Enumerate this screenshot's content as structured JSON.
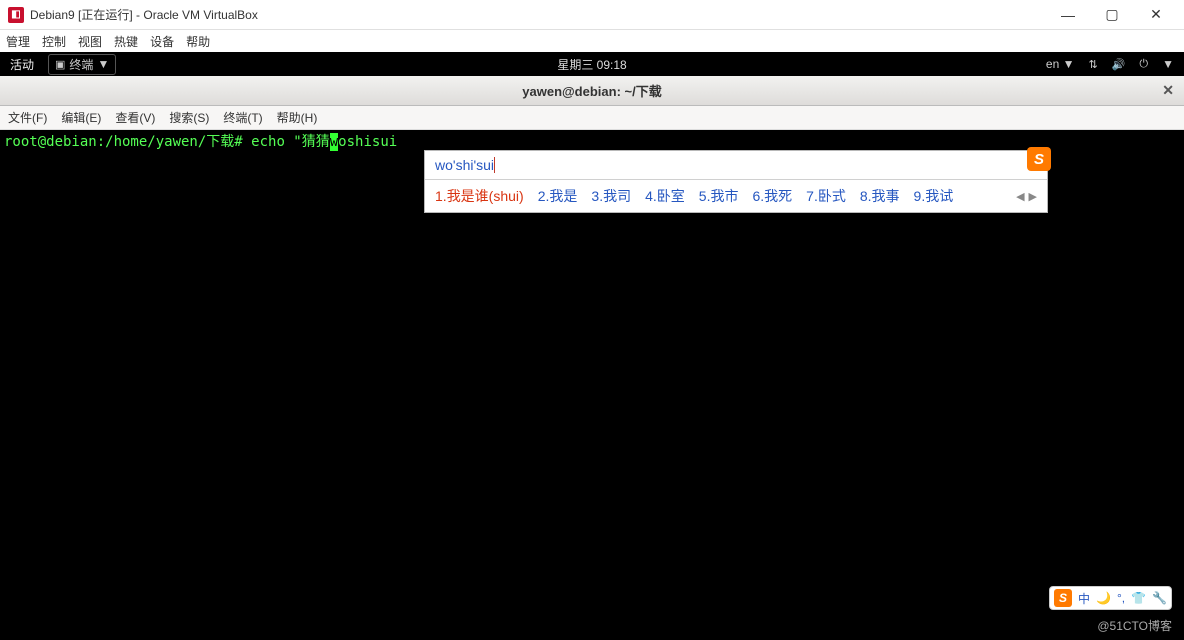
{
  "vbox": {
    "title": "Debian9 [正在运行] - Oracle VM VirtualBox",
    "menu": [
      "管理",
      "控制",
      "视图",
      "热键",
      "设备",
      "帮助"
    ]
  },
  "gnome": {
    "activities": "活动",
    "app_icon": "▣",
    "app_name": "终端",
    "clock": "星期三 09:18",
    "lang": "en",
    "dropdown": "▼"
  },
  "terminal": {
    "title": "yawen@debian: ~/下载",
    "menu": [
      "文件(F)",
      "编辑(E)",
      "查看(V)",
      "搜索(S)",
      "终端(T)",
      "帮助(H)"
    ],
    "prompt": "root@debian:/home/yawen/下载#",
    "command": "echo \"猜猜",
    "comp_char": "w",
    "comp_rest": "oshisui"
  },
  "ime": {
    "input": "wo'shi'sui",
    "logo": "S",
    "candidates": [
      {
        "n": "1",
        "text": "我是谁(shui)"
      },
      {
        "n": "2",
        "text": "我是"
      },
      {
        "n": "3",
        "text": "我司"
      },
      {
        "n": "4",
        "text": "卧室"
      },
      {
        "n": "5",
        "text": "我市"
      },
      {
        "n": "6",
        "text": "我死"
      },
      {
        "n": "7",
        "text": "卧式"
      },
      {
        "n": "8",
        "text": "我事"
      },
      {
        "n": "9",
        "text": "我试"
      }
    ],
    "pager_prev": "◀",
    "pager_next": "▶"
  },
  "sogou": {
    "s": "S",
    "items": [
      "中",
      "🌙",
      "°,",
      "👕",
      "🔧"
    ]
  },
  "watermark": "@51CTO博客"
}
